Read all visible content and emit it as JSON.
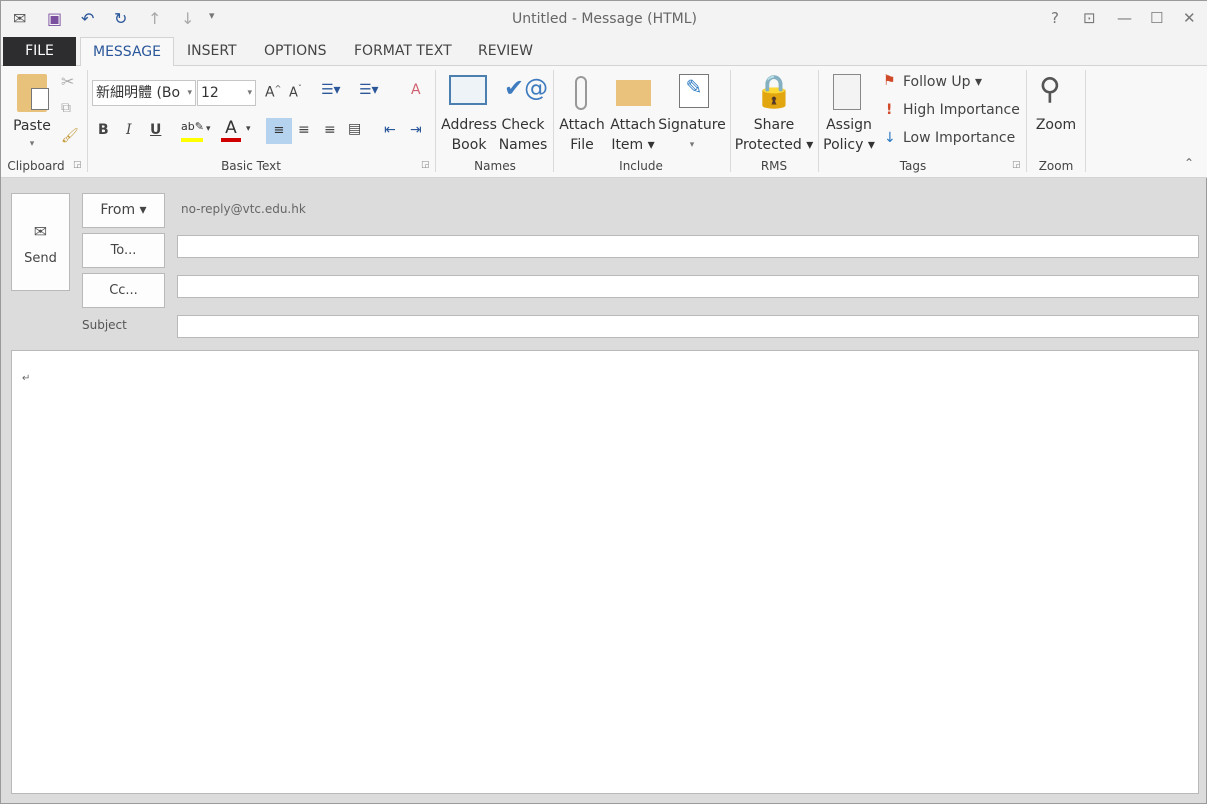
{
  "window": {
    "title": "Untitled - Message (HTML)",
    "help": "?",
    "restore_ribbon": "⊡",
    "minimize": "—",
    "maximize": "☐",
    "close": "✕"
  },
  "quick_access": {
    "save": "save-icon",
    "undo": "↶",
    "redo": "↻",
    "up": "↑",
    "down": "↓",
    "customize": "▾"
  },
  "tabs": [
    {
      "label": "FILE"
    },
    {
      "label": "MESSAGE"
    },
    {
      "label": "INSERT"
    },
    {
      "label": "OPTIONS"
    },
    {
      "label": "FORMAT TEXT"
    },
    {
      "label": "REVIEW"
    }
  ],
  "ribbon": {
    "clipboard": {
      "paste": "Paste",
      "group": "Clipboard"
    },
    "basic_text": {
      "font": "新細明體 (Bo",
      "size": "12",
      "bold": "B",
      "italic": "I",
      "underline": "U",
      "group": "Basic Text"
    },
    "names": {
      "address_book": [
        "Address",
        "Book"
      ],
      "check_names": [
        "Check",
        "Names"
      ],
      "group": "Names"
    },
    "include": {
      "attach_file": [
        "Attach",
        "File"
      ],
      "attach_item": [
        "Attach",
        "Item ▾"
      ],
      "signature": [
        "Signature",
        "▾"
      ],
      "group": "Include"
    },
    "rms": {
      "share_protected": [
        "Share",
        "Protected ▾"
      ],
      "group": "RMS"
    },
    "tags": {
      "assign_policy": [
        "Assign",
        "Policy ▾"
      ],
      "follow_up": "Follow Up ▾",
      "high": "High Importance",
      "low": "Low Importance",
      "group": "Tags"
    },
    "zoom": {
      "zoom": "Zoom",
      "group": "Zoom"
    },
    "colors": {
      "highlight": "#ffff00",
      "font_color": "#d00000",
      "accent": "#2b579a"
    }
  },
  "compose": {
    "send": "Send",
    "from_button": "From ▾",
    "from_value": "no-reply@vtc.edu.hk",
    "to_button": "To...",
    "cc_button": "Cc...",
    "subject_label": "Subject",
    "to_value": "",
    "cc_value": "",
    "subject_value": "",
    "body_mark": "↵"
  }
}
